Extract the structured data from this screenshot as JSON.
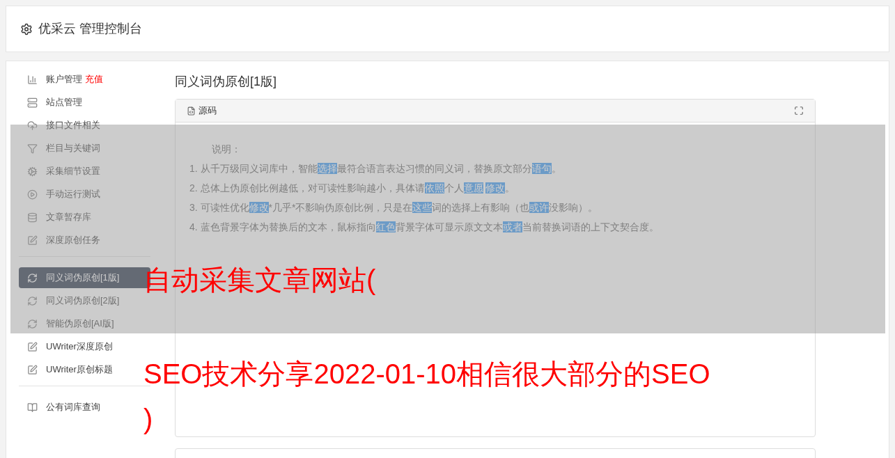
{
  "header": {
    "title": "优采云 管理控制台"
  },
  "sidebar": {
    "groups": [
      {
        "items": [
          {
            "label": "账户管理",
            "badge": "充值",
            "selected": false
          },
          {
            "label": "站点管理",
            "selected": false
          },
          {
            "label": "接口文件相关",
            "selected": false
          },
          {
            "label": "栏目与关键词",
            "selected": false
          },
          {
            "label": "采集细节设置",
            "selected": false
          },
          {
            "label": "手动运行测试",
            "selected": false
          },
          {
            "label": "文章暂存库",
            "selected": false
          },
          {
            "label": "深度原创任务",
            "selected": false
          }
        ]
      },
      {
        "items": [
          {
            "label": "同义词伪原创[1版]",
            "selected": true
          },
          {
            "label": "同义词伪原创[2版]",
            "selected": false
          },
          {
            "label": "智能伪原创[AI版]",
            "selected": false
          },
          {
            "label": "UWriter深度原创",
            "selected": false
          },
          {
            "label": "UWriter原创标题",
            "selected": false
          }
        ]
      },
      {
        "items": [
          {
            "label": "公有词库查询",
            "selected": false
          }
        ]
      }
    ]
  },
  "content": {
    "title": "同义词伪原创[1版]",
    "editor": {
      "tab": "源码",
      "intro": "说明：",
      "lines": [
        [
          {
            "text": "1. 从千万级同义词库中，智能",
            "highlighted": false
          },
          {
            "text": "选择",
            "highlighted": true
          },
          {
            "text": "最符合语言表达习惯的同义词，替换原文部分",
            "highlighted": false
          },
          {
            "text": "语句",
            "highlighted": true
          },
          {
            "text": "。",
            "highlighted": false
          }
        ],
        [
          {
            "text": "2. 总体上伪原创比例越低，对可读性影响越小，具体请",
            "highlighted": false
          },
          {
            "text": "依照",
            "highlighted": true
          },
          {
            "text": "个人",
            "highlighted": false
          },
          {
            "text": "意愿",
            "highlighted": true
          },
          {
            "text": "修改",
            "highlighted": true
          },
          {
            "text": "。",
            "highlighted": false
          }
        ],
        [
          {
            "text": "3. 可读性优化",
            "highlighted": false
          },
          {
            "text": "修改",
            "highlighted": true
          },
          {
            "text": "*几乎*不影响伪原创比例，只是在",
            "highlighted": false
          },
          {
            "text": "这些",
            "highlighted": true
          },
          {
            "text": "词的选择上有影响（也",
            "highlighted": false
          },
          {
            "text": "或许",
            "highlighted": true
          },
          {
            "text": "没影响）。",
            "highlighted": false
          }
        ],
        [
          {
            "text": "4. 蓝色背景字体为替换后的文本，鼠标指向",
            "highlighted": false
          },
          {
            "text": "红色",
            "highlighted": true
          },
          {
            "text": "背景字体可显示原文文本",
            "highlighted": false
          },
          {
            "text": "或者",
            "highlighted": true
          },
          {
            "text": "当前替换词语的上下文契合度。",
            "highlighted": false
          }
        ]
      ]
    }
  },
  "overlay_caption": {
    "lines": [
      "自动采集文章网站(",
      "SEO技术分享2022-01-10相信很大部分的SEO",
      ")"
    ]
  }
}
